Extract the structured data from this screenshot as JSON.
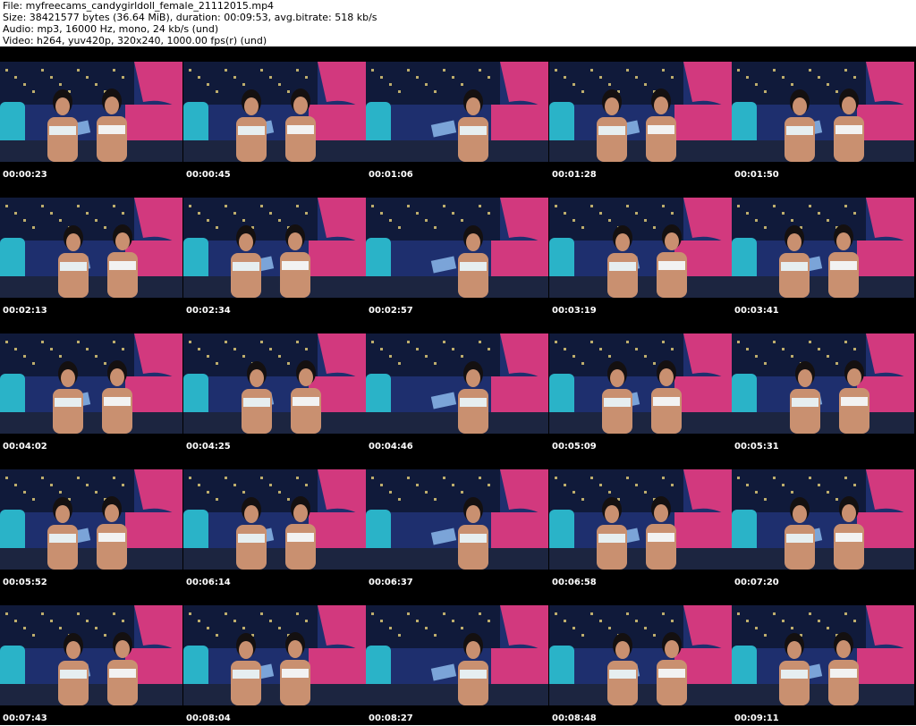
{
  "header": {
    "file": "File: myfreecams_candygirldoll_female_21112015.mp4",
    "size": "Size: 38421577 bytes (36.64 MiB), duration: 00:09:53, avg.bitrate: 518 kb/s",
    "audio": "Audio: mp3, 16000 Hz, mono, 24 kb/s (und)",
    "video": "Video: h264, yuv420p, 320x240, 1000.00 fps(r) (und)"
  },
  "frames": [
    {
      "time": "00:00:23"
    },
    {
      "time": "00:00:45"
    },
    {
      "time": "00:01:06"
    },
    {
      "time": "00:01:28"
    },
    {
      "time": "00:01:50"
    },
    {
      "time": "00:02:13"
    },
    {
      "time": "00:02:34"
    },
    {
      "time": "00:02:57"
    },
    {
      "time": "00:03:19"
    },
    {
      "time": "00:03:41"
    },
    {
      "time": "00:04:02"
    },
    {
      "time": "00:04:25"
    },
    {
      "time": "00:04:46"
    },
    {
      "time": "00:05:09"
    },
    {
      "time": "00:05:31"
    },
    {
      "time": "00:05:52"
    },
    {
      "time": "00:06:14"
    },
    {
      "time": "00:06:37"
    },
    {
      "time": "00:06:58"
    },
    {
      "time": "00:07:20"
    },
    {
      "time": "00:07:43"
    },
    {
      "time": "00:08:04"
    },
    {
      "time": "00:08:27"
    },
    {
      "time": "00:08:48"
    },
    {
      "time": "00:09:11"
    }
  ],
  "colors": {
    "background": "#000000",
    "timestamp": "#ffffff",
    "backdrop_blue": "#1e2f6e",
    "backdrop_pink": "#d2397e",
    "cushion_teal": "#2ab3c8",
    "skin": "#c99070"
  }
}
